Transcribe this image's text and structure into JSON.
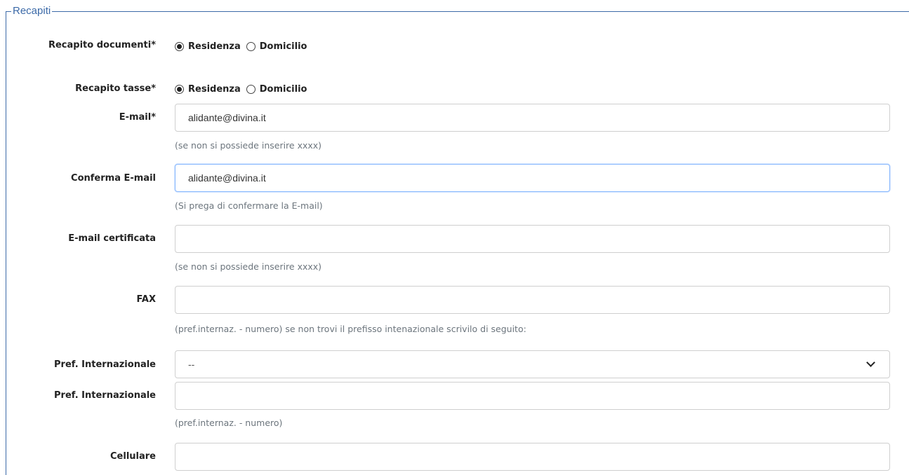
{
  "section": {
    "legend": "Recapiti"
  },
  "recapito_documenti": {
    "label": "Recapito documenti*",
    "options": [
      {
        "label": "Residenza",
        "checked": true
      },
      {
        "label": "Domicilio",
        "checked": false
      }
    ]
  },
  "recapito_tasse": {
    "label": "Recapito tasse*",
    "options": [
      {
        "label": "Residenza",
        "checked": true
      },
      {
        "label": "Domicilio",
        "checked": false
      }
    ]
  },
  "email": {
    "label": "E-mail*",
    "value": "alidante@divina.it",
    "help": "(se non si possiede inserire xxxx)"
  },
  "conferma_email": {
    "label": "Conferma E-mail",
    "value": "alidante@divina.it",
    "help": "(Si prega di confermare la E-mail)"
  },
  "email_certificata": {
    "label": "E-mail certificata",
    "value": "",
    "help": "(se non si possiede inserire xxxx)"
  },
  "fax": {
    "label": "FAX",
    "value": "",
    "help": "(pref.internaz. - numero) se non trovi il prefisso intenazionale scrivilo di seguito:"
  },
  "pref_internazionale_select": {
    "label": "Pref. Internazionale",
    "selected": "--"
  },
  "pref_internazionale_input": {
    "label": "Pref. Internazionale",
    "value": "",
    "help": "(pref.internaz. - numero)"
  },
  "cellulare": {
    "label": "Cellulare",
    "value": ""
  }
}
